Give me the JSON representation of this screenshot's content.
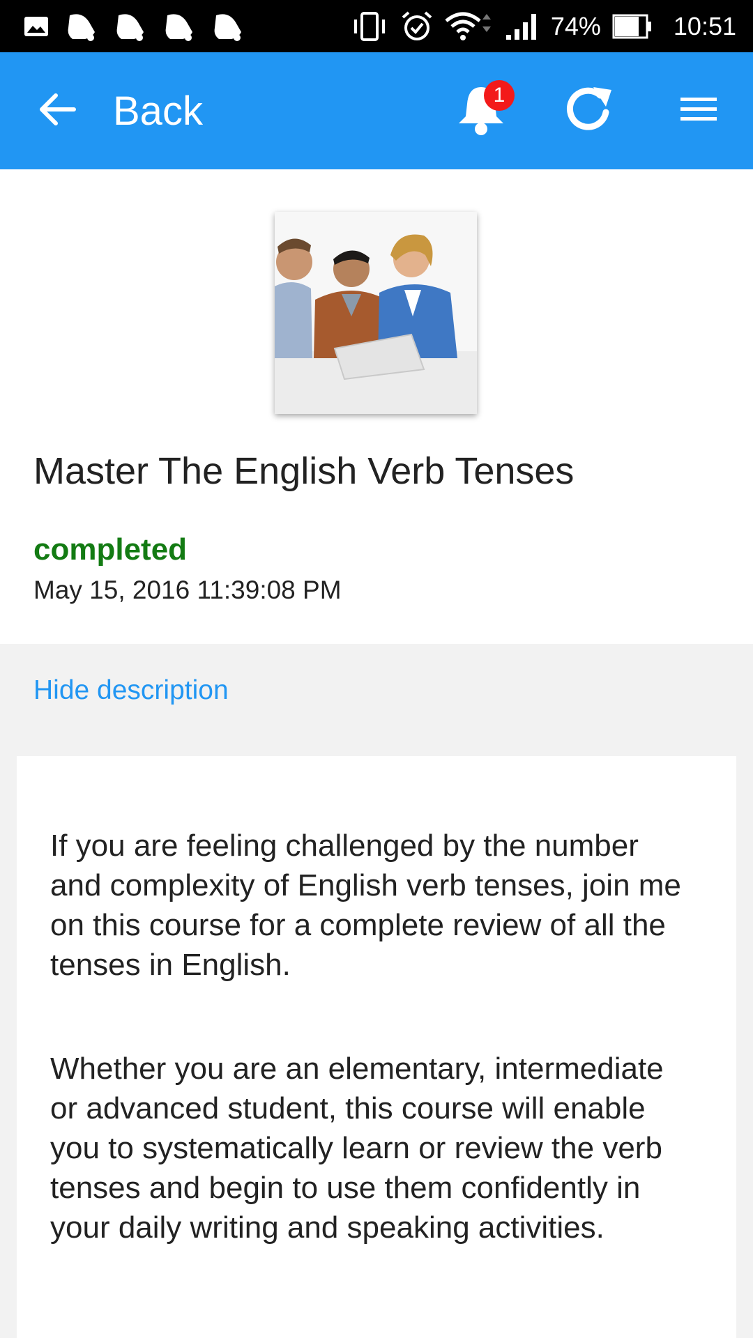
{
  "status_bar": {
    "battery_percent": "74%",
    "time": "10:51",
    "icons": [
      "gallery-icon",
      "notification-bell-icon",
      "notification-bell-icon",
      "notification-bell-icon",
      "notification-bell-icon",
      "vibrate-icon",
      "alarm-icon",
      "wifi-icon",
      "signal-icon",
      "battery-icon"
    ]
  },
  "appbar": {
    "back_label": "Back",
    "notification_count": "1",
    "background_color": "#2196f3",
    "badge_color": "#f31a1a"
  },
  "course": {
    "title": "Master The English Verb Tenses",
    "status": "completed",
    "status_color": "#137b13",
    "completed_at": "May 15, 2016 11:39:08 PM"
  },
  "description": {
    "toggle_label": "Hide description",
    "paragraphs": [
      "If you are feeling challenged by the number and complexity of English verb tenses, join me on this course for a complete review of all the tenses in English.",
      "Whether you are an elementary, intermediate or advanced student, this course will enable you to systematically learn or review the verb tenses and begin to use them confidently in your daily writing and speaking activities."
    ]
  }
}
